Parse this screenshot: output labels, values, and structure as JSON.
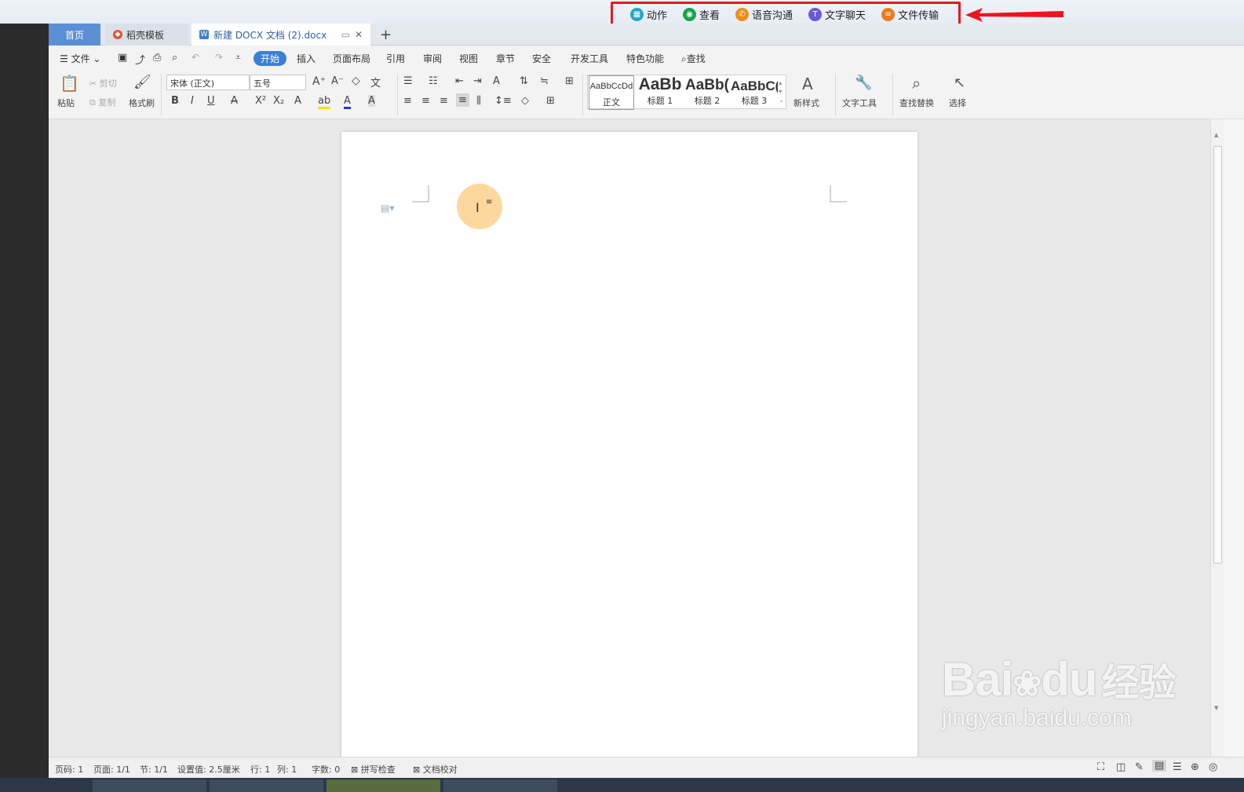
{
  "remote_bar": {
    "items": [
      {
        "label": "动作",
        "color": "#22a6c9",
        "icon": "grid-icon"
      },
      {
        "label": "查看",
        "color": "#1aa34a",
        "icon": "eye-icon"
      },
      {
        "label": "语音沟通",
        "color": "#f08c1a",
        "icon": "phone-icon"
      },
      {
        "label": "文字聊天",
        "color": "#6a59d6",
        "icon": "chat-t-icon"
      },
      {
        "label": "文件传输",
        "color": "#f07a20",
        "icon": "file-icon"
      }
    ],
    "highlight_color": "#f0131e"
  },
  "tabs": {
    "home": "首页",
    "template": "稻壳模板",
    "doc": "新建 DOCX 文档 (2).docx",
    "new": "+"
  },
  "menubar": {
    "file": "文件",
    "items": [
      "开始",
      "插入",
      "页面布局",
      "引用",
      "审阅",
      "视图",
      "章节",
      "安全",
      "开发工具",
      "特色功能"
    ],
    "search": "查找"
  },
  "ribbon": {
    "paste": "粘贴",
    "cut": "剪切",
    "copy": "复制",
    "format_painter": "格式刷",
    "font_name": "宋体 (正文)",
    "font_size": "五号",
    "bold": "B",
    "italic": "I",
    "underline": "U",
    "styles": [
      {
        "preview": "AaBbCcDd",
        "label": "正文"
      },
      {
        "preview": "AaBb",
        "label": "标题 1"
      },
      {
        "preview": "AaBb(",
        "label": "标题 2"
      },
      {
        "preview": "AaBbC(",
        "label": "标题 3"
      }
    ],
    "new_style": "新样式",
    "text_tools": "文字工具",
    "find_replace": "查找替换",
    "select": "选择"
  },
  "status": {
    "page_num": "页码: 1",
    "pages": "页面: 1/1",
    "section": "节: 1/1",
    "setting": "设置值: 2.5厘米",
    "row": "行: 1",
    "col": "列: 1",
    "words": "字数: 0",
    "spell": "拼写检查",
    "proof": "文档校对"
  },
  "watermark": {
    "brand": "Bai",
    "brand2": "du",
    "cn": "经验",
    "url": "jingyan.baidu.com"
  }
}
